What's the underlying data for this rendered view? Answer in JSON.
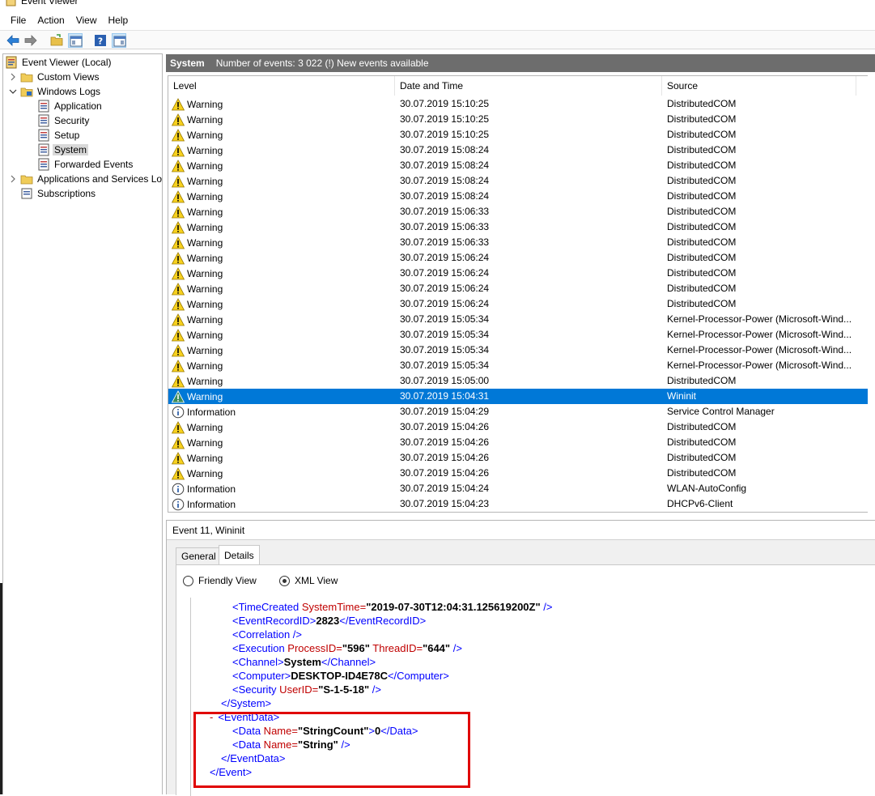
{
  "window": {
    "title": "Event Viewer"
  },
  "menu": [
    "File",
    "Action",
    "View",
    "Help"
  ],
  "toolbar": {
    "icons": [
      "back-arrow-icon",
      "forward-arrow-icon",
      "open-folder-icon",
      "console-tree-icon",
      "help-icon",
      "action-pane-icon"
    ]
  },
  "tree": {
    "root": "Event Viewer (Local)",
    "custom_views": "Custom Views",
    "windows_logs": "Windows Logs",
    "application": "Application",
    "security": "Security",
    "setup": "Setup",
    "system": "System",
    "forwarded": "Forwarded Events",
    "apps_services": "Applications and Services Lo",
    "subscriptions": "Subscriptions"
  },
  "main": {
    "log_name": "System",
    "summary": "Number of events: 3 022 (!) New events available",
    "columns": {
      "level": "Level",
      "date": "Date and Time",
      "source": "Source"
    }
  },
  "events": [
    {
      "level": "Warning",
      "date": "30.07.2019 15:10:25",
      "source": "DistributedCOM"
    },
    {
      "level": "Warning",
      "date": "30.07.2019 15:10:25",
      "source": "DistributedCOM"
    },
    {
      "level": "Warning",
      "date": "30.07.2019 15:10:25",
      "source": "DistributedCOM"
    },
    {
      "level": "Warning",
      "date": "30.07.2019 15:08:24",
      "source": "DistributedCOM"
    },
    {
      "level": "Warning",
      "date": "30.07.2019 15:08:24",
      "source": "DistributedCOM"
    },
    {
      "level": "Warning",
      "date": "30.07.2019 15:08:24",
      "source": "DistributedCOM"
    },
    {
      "level": "Warning",
      "date": "30.07.2019 15:08:24",
      "source": "DistributedCOM"
    },
    {
      "level": "Warning",
      "date": "30.07.2019 15:06:33",
      "source": "DistributedCOM"
    },
    {
      "level": "Warning",
      "date": "30.07.2019 15:06:33",
      "source": "DistributedCOM"
    },
    {
      "level": "Warning",
      "date": "30.07.2019 15:06:33",
      "source": "DistributedCOM"
    },
    {
      "level": "Warning",
      "date": "30.07.2019 15:06:24",
      "source": "DistributedCOM"
    },
    {
      "level": "Warning",
      "date": "30.07.2019 15:06:24",
      "source": "DistributedCOM"
    },
    {
      "level": "Warning",
      "date": "30.07.2019 15:06:24",
      "source": "DistributedCOM"
    },
    {
      "level": "Warning",
      "date": "30.07.2019 15:06:24",
      "source": "DistributedCOM"
    },
    {
      "level": "Warning",
      "date": "30.07.2019 15:05:34",
      "source": "Kernel-Processor-Power (Microsoft-Wind..."
    },
    {
      "level": "Warning",
      "date": "30.07.2019 15:05:34",
      "source": "Kernel-Processor-Power (Microsoft-Wind..."
    },
    {
      "level": "Warning",
      "date": "30.07.2019 15:05:34",
      "source": "Kernel-Processor-Power (Microsoft-Wind..."
    },
    {
      "level": "Warning",
      "date": "30.07.2019 15:05:34",
      "source": "Kernel-Processor-Power (Microsoft-Wind..."
    },
    {
      "level": "Warning",
      "date": "30.07.2019 15:05:00",
      "source": "DistributedCOM"
    },
    {
      "level": "Warning",
      "date": "30.07.2019 15:04:31",
      "source": "Wininit",
      "selected": true
    },
    {
      "level": "Information",
      "date": "30.07.2019 15:04:29",
      "source": "Service Control Manager"
    },
    {
      "level": "Warning",
      "date": "30.07.2019 15:04:26",
      "source": "DistributedCOM"
    },
    {
      "level": "Warning",
      "date": "30.07.2019 15:04:26",
      "source": "DistributedCOM"
    },
    {
      "level": "Warning",
      "date": "30.07.2019 15:04:26",
      "source": "DistributedCOM"
    },
    {
      "level": "Warning",
      "date": "30.07.2019 15:04:26",
      "source": "DistributedCOM"
    },
    {
      "level": "Information",
      "date": "30.07.2019 15:04:24",
      "source": "WLAN-AutoConfig"
    },
    {
      "level": "Information",
      "date": "30.07.2019 15:04:23",
      "source": "DHCPv6-Client"
    }
  ],
  "details": {
    "title": "Event 11, Wininit",
    "tabs": [
      "General",
      "Details"
    ],
    "view_options": {
      "friendly": "Friendly View",
      "xml": "XML View"
    },
    "xml": {
      "time_created_tag": "<TimeCreated",
      "time_created_attr": " SystemTime=",
      "time_created_val": "\"2019-07-30T12:04:31.125619200Z\"",
      "time_created_end": " />",
      "record_open": "<EventRecordID>",
      "record_val": "2823",
      "record_close": "</EventRecordID>",
      "correlation": "<Correlation />",
      "execution_tag": "<Execution",
      "execution_attr1": " ProcessID=",
      "execution_val1": "\"596\"",
      "execution_attr2": " ThreadID=",
      "execution_val2": "\"644\"",
      "execution_end": " />",
      "channel_open": "<Channel>",
      "channel_val": "System",
      "channel_close": "</Channel>",
      "computer_open": "<Computer>",
      "computer_val": "DESKTOP-ID4E78C",
      "computer_close": "</Computer>",
      "security_tag": "<Security",
      "security_attr": " UserID=",
      "security_val": "\"S-1-5-18\"",
      "security_end": " />",
      "system_close": "</System>",
      "collapse": "-",
      "eventdata_open": "<EventData>",
      "data1_tag": "<Data",
      "data1_attr": " Name=",
      "data1_name": "\"StringCount\"",
      "data1_gt": ">",
      "data1_val": "0",
      "data1_close": "</Data>",
      "data2_tag": "<Data",
      "data2_attr": " Name=",
      "data2_name": "\"String\"",
      "data2_end": " />",
      "eventdata_close": "</EventData>",
      "event_close": "</Event>"
    }
  }
}
